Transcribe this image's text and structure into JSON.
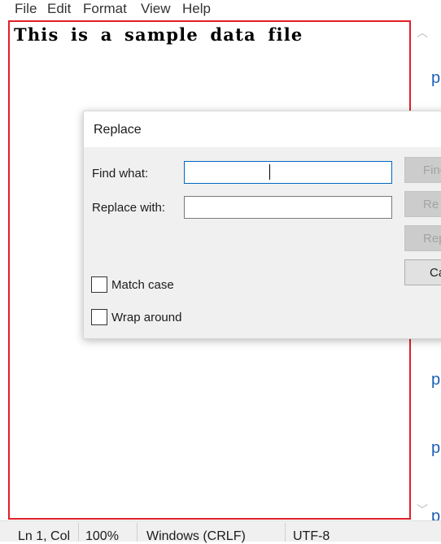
{
  "menu": [
    "File",
    "Edit",
    "Format",
    "View",
    "Help"
  ],
  "editor": {
    "text": "This is a sample data file"
  },
  "edge_fragments": [
    "p",
    "p",
    "p",
    "p"
  ],
  "dialog": {
    "title": "Replace",
    "find_label": "Find what:",
    "find_value": "",
    "replace_label": "Replace with:",
    "replace_value": "",
    "buttons": [
      "Find",
      "Re",
      "Rep",
      "Ca"
    ],
    "match_case_label": "Match case",
    "wrap_around_label": "Wrap around",
    "match_case_checked": false,
    "wrap_around_checked": false
  },
  "status": {
    "position": "Ln 1, Col",
    "zoom": "100%",
    "line_endings": "Windows (CRLF)",
    "encoding": "UTF-8"
  },
  "colors": {
    "selection_frame": "#e01f28",
    "link_blue": "#1a5fb4",
    "focus_border": "#0067c0"
  },
  "icons": {
    "scroll_up": "chevron-up-icon",
    "scroll_down": "chevron-down-icon"
  }
}
